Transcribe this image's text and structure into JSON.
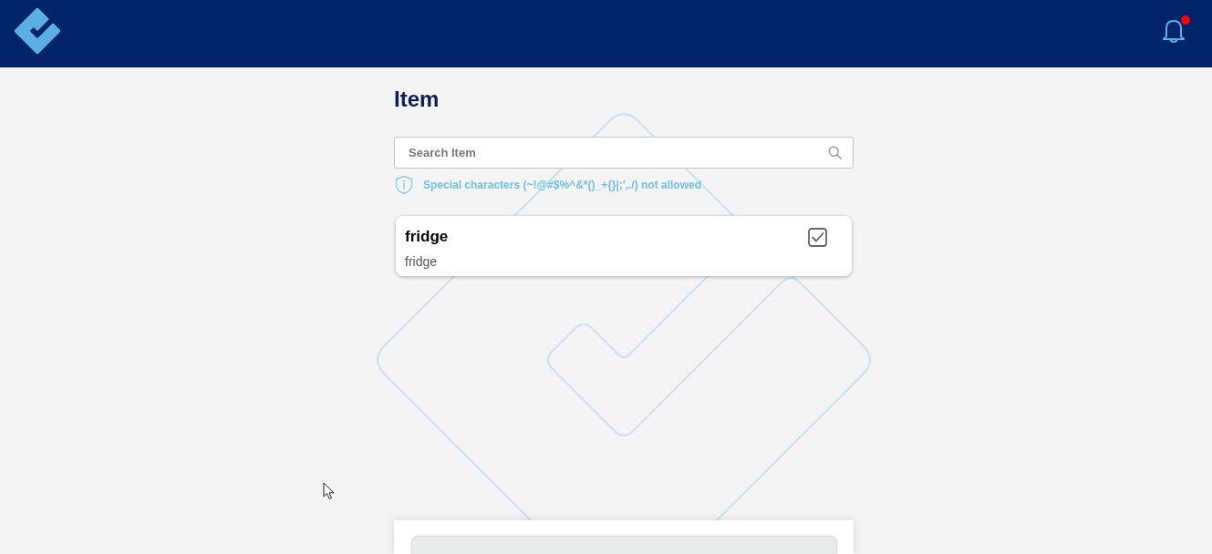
{
  "header": {
    "notification": {
      "unread": true
    }
  },
  "page": {
    "title": "Item"
  },
  "search": {
    "placeholder": "Search Item"
  },
  "hint": "Special characters (~!@#$%^&*()_+{}|;',./) not allowed",
  "items": [
    {
      "title": "fridge",
      "subtitle": "fridge",
      "checked": true
    }
  ]
}
